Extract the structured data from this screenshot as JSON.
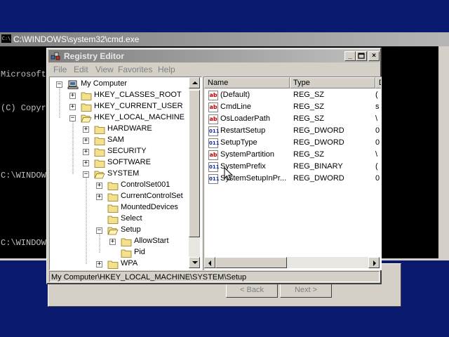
{
  "wizard": {
    "back_label": "< Back",
    "next_label": "Next >"
  },
  "cmd": {
    "title": "C:\\WINDOWS\\system32\\cmd.exe",
    "icon_text": "C:\\",
    "lines": [
      "Microsoft",
      "(C) Copyr",
      "",
      "C:\\WINDOW",
      "",
      "C:\\WINDOW"
    ]
  },
  "regedit": {
    "title": "Registry Editor",
    "menu": [
      "File",
      "Edit",
      "View",
      "Favorites",
      "Help"
    ],
    "tree": [
      {
        "label": "My Computer",
        "expanded": true
      },
      {
        "label": "HKEY_CLASSES_ROOT",
        "expanded": false
      },
      {
        "label": "HKEY_CURRENT_USER",
        "expanded": false
      },
      {
        "label": "HKEY_LOCAL_MACHINE",
        "expanded": true
      },
      {
        "label": "HARDWARE",
        "expanded": false
      },
      {
        "label": "SAM",
        "expanded": false
      },
      {
        "label": "SECURITY",
        "expanded": false
      },
      {
        "label": "SOFTWARE",
        "expanded": false
      },
      {
        "label": "SYSTEM",
        "expanded": true
      },
      {
        "label": "ControlSet001",
        "expanded": false
      },
      {
        "label": "CurrentControlSet",
        "expanded": false
      },
      {
        "label": "MountedDevices",
        "expanded": null
      },
      {
        "label": "Select",
        "expanded": null
      },
      {
        "label": "Setup",
        "expanded": true
      },
      {
        "label": "AllowStart",
        "expanded": false
      },
      {
        "label": "Pid",
        "expanded": null
      },
      {
        "label": "WPA",
        "expanded": false
      }
    ],
    "columns": {
      "name": "Name",
      "type": "Type",
      "data": "D"
    },
    "values": [
      {
        "name": "(Default)",
        "type": "REG_SZ",
        "kind": "sz",
        "data": "("
      },
      {
        "name": "CmdLine",
        "type": "REG_SZ",
        "kind": "sz",
        "data": "s"
      },
      {
        "name": "OsLoaderPath",
        "type": "REG_SZ",
        "kind": "sz",
        "data": "\\"
      },
      {
        "name": "RestartSetup",
        "type": "REG_DWORD",
        "kind": "bin",
        "data": "0"
      },
      {
        "name": "SetupType",
        "type": "REG_DWORD",
        "kind": "bin",
        "data": "0"
      },
      {
        "name": "SystemPartition",
        "type": "REG_SZ",
        "kind": "sz",
        "data": "\\"
      },
      {
        "name": "SystemPrefix",
        "type": "REG_BINARY",
        "kind": "bin",
        "data": "("
      },
      {
        "name": "SystemSetupInPr...",
        "type": "REG_DWORD",
        "kind": "bin",
        "data": "0"
      }
    ],
    "status": "My Computer\\HKEY_LOCAL_MACHINE\\SYSTEM\\Setup"
  }
}
